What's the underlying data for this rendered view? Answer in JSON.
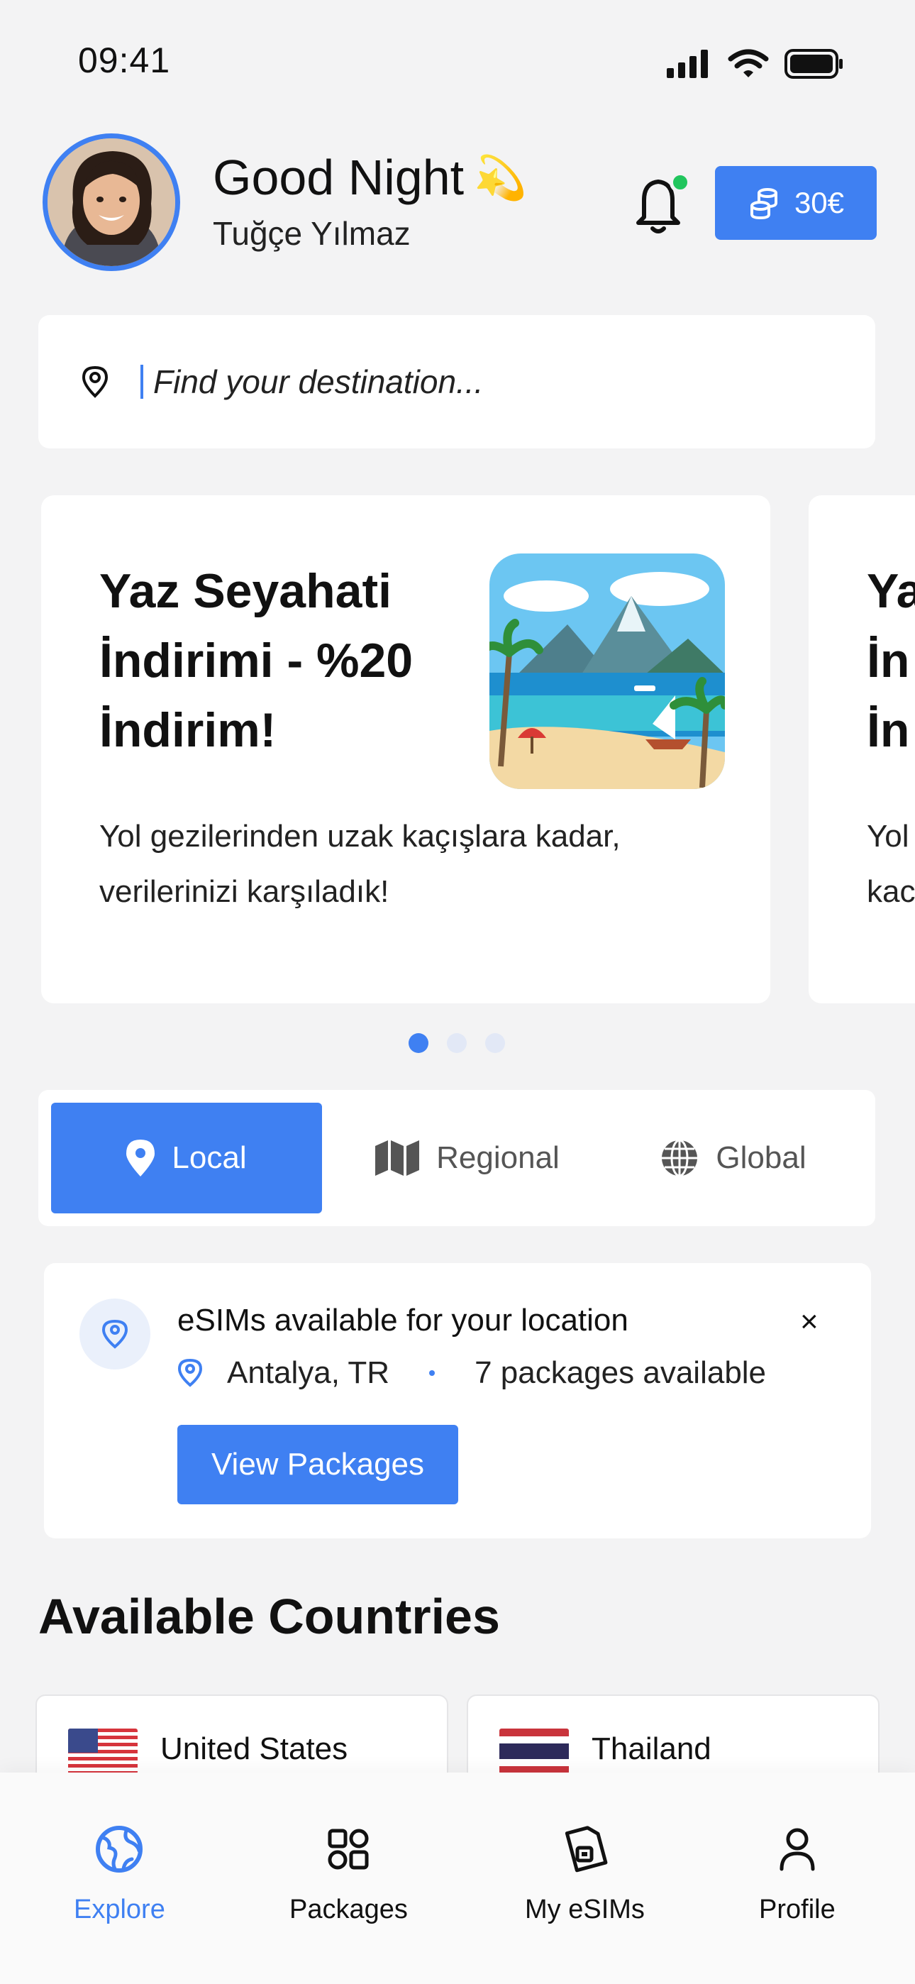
{
  "status_bar": {
    "time": "09:41"
  },
  "header": {
    "greeting": "Good Night",
    "greeting_emoji": "💫",
    "user_name": "Tuğçe Yılmaz",
    "notification_dot_color": "#21c55d",
    "balance": "30€"
  },
  "search": {
    "placeholder": "Find your destination..."
  },
  "promo": {
    "title": "Yaz Seyahati İndirimi - %20 İndirim!",
    "description": "Yol gezilerinden uzak kaçışlara kadar, verilerinizi karşıladık!",
    "next_title_fragment": "Ya\nİn\nİn",
    "next_desc_fragment": "Yol\nkac",
    "dots_total": 3,
    "active_dot": 0
  },
  "tabs": [
    {
      "label": "Local",
      "icon": "pin-icon",
      "active": true
    },
    {
      "label": "Regional",
      "icon": "map-icon",
      "active": false
    },
    {
      "label": "Global",
      "icon": "globe-icon",
      "active": false
    }
  ],
  "location_card": {
    "title": "eSIMs available for your location",
    "location": "Antalya, TR",
    "packages": "7 packages available",
    "button": "View Packages",
    "close": "×"
  },
  "section_title": "Available Countries",
  "countries": [
    {
      "name": "United States",
      "flag": "us-flag-icon"
    },
    {
      "name": "Thailand",
      "flag": "th-flag-icon"
    }
  ],
  "bottom_nav": [
    {
      "label": "Explore",
      "icon": "explore-globe-icon",
      "active": true
    },
    {
      "label": "Packages",
      "icon": "packages-grid-icon",
      "active": false
    },
    {
      "label": "My eSIMs",
      "icon": "esim-card-icon",
      "active": false
    },
    {
      "label": "Profile",
      "icon": "profile-user-icon",
      "active": false
    }
  ],
  "colors": {
    "accent": "#3f80f2",
    "background": "#f3f3f4"
  }
}
